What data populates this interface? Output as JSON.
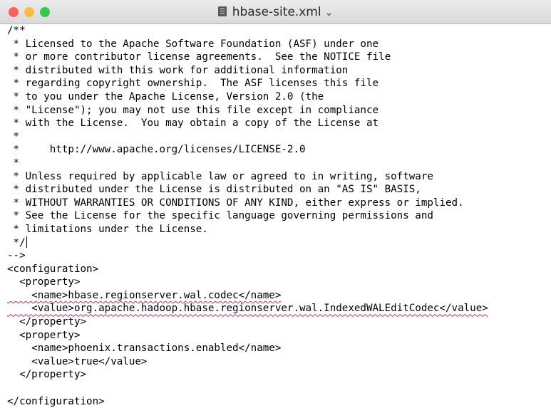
{
  "window": {
    "title": "hbase-site.xml",
    "colors": {
      "close": "#fc605c",
      "minimize": "#fdbc40",
      "maximize": "#34c84a"
    }
  },
  "editor": {
    "lines": [
      "/**",
      " * Licensed to the Apache Software Foundation (ASF) under one",
      " * or more contributor license agreements.  See the NOTICE file",
      " * distributed with this work for additional information",
      " * regarding copyright ownership.  The ASF licenses this file",
      " * to you under the Apache License, Version 2.0 (the",
      " * \"License\"); you may not use this file except in compliance",
      " * with the License.  You may obtain a copy of the License at",
      " *",
      " *     http://www.apache.org/licenses/LICENSE-2.0",
      " *",
      " * Unless required by applicable law or agreed to in writing, software",
      " * distributed under the License is distributed on an \"AS IS\" BASIS,",
      " * WITHOUT WARRANTIES OR CONDITIONS OF ANY KIND, either express or implied.",
      " * See the License for the specific language governing permissions and",
      " * limitations under the License.",
      " */",
      "-->",
      "<configuration>",
      "  <property>",
      "    <name>hbase.regionserver.wal.codec</name>",
      "    <value>org.apache.hadoop.hbase.regionserver.wal.IndexedWALEditCodec</value>",
      "  </property>",
      "  <property>",
      "    <name>phoenix.transactions.enabled</name>",
      "    <value>true</value>",
      "  </property>",
      "",
      "</configuration>"
    ]
  }
}
